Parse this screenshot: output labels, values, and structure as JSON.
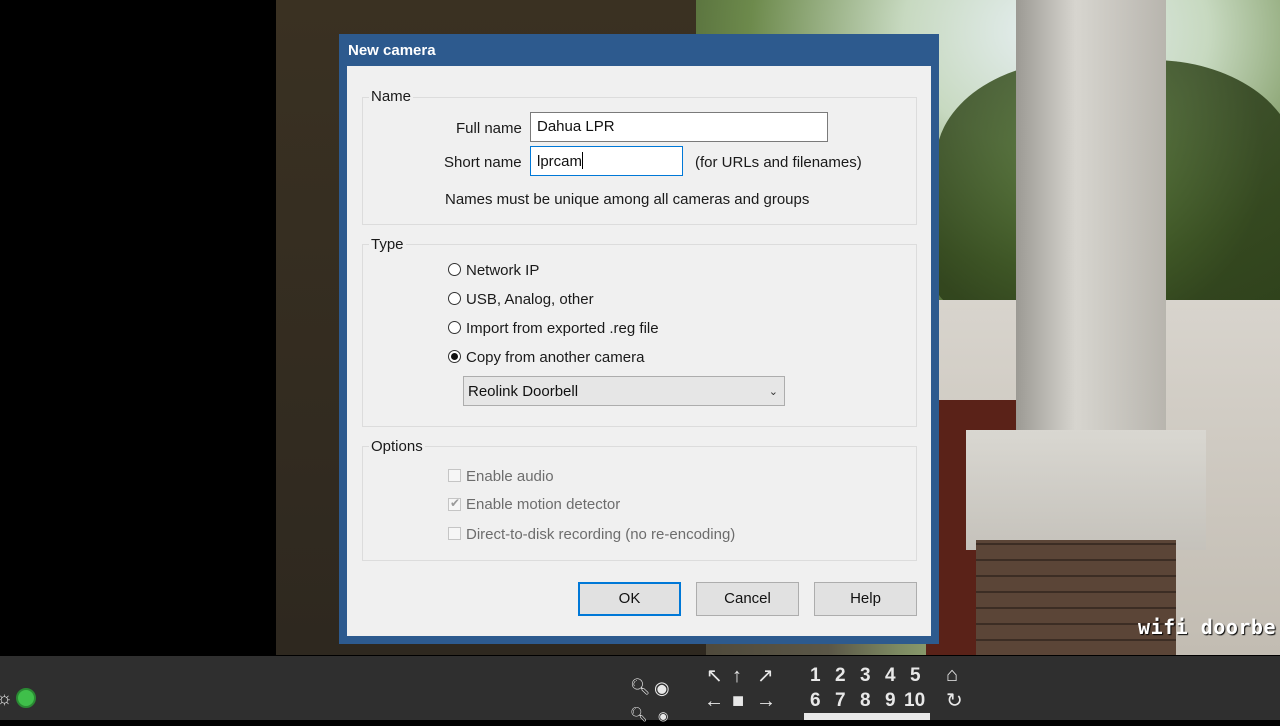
{
  "camera_feed": {
    "overlay_label": "wifi doorbe"
  },
  "dialog": {
    "title": "New camera",
    "name_group": {
      "title": "Name",
      "full_name_label": "Full name",
      "full_name_value": "Dahua LPR",
      "short_name_label": "Short name",
      "short_name_value": "lprcam",
      "short_name_hint": "(for URLs and filenames)",
      "uniqueness_note": "Names must be unique among all cameras and groups"
    },
    "type_group": {
      "title": "Type",
      "options": [
        {
          "label": "Network IP",
          "checked": false
        },
        {
          "label": "USB, Analog, other",
          "checked": false
        },
        {
          "label": "Import from exported .reg file",
          "checked": false
        },
        {
          "label": "Copy from another camera",
          "checked": true
        }
      ],
      "copy_source_selected": "Reolink Doorbell"
    },
    "options_group": {
      "title": "Options",
      "options": [
        {
          "label": "Enable audio",
          "checked": false,
          "enabled": false
        },
        {
          "label": "Enable motion detector",
          "checked": true,
          "enabled": false
        },
        {
          "label": "Direct-to-disk recording (no re-encoding)",
          "checked": false,
          "enabled": false
        }
      ]
    },
    "buttons": {
      "ok": "OK",
      "cancel": "Cancel",
      "help": "Help"
    }
  },
  "bottom_bar": {
    "camera_numbers_row1": [
      "1",
      "2",
      "3",
      "4",
      "5"
    ],
    "camera_numbers_row2": [
      "6",
      "7",
      "8",
      "9",
      "10"
    ]
  },
  "colors": {
    "title_bar": "#2d5a8e",
    "focus_blue": "#0078d7",
    "dialog_bg": "#f0f0f0"
  }
}
